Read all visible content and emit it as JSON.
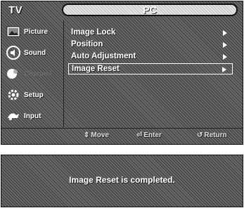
{
  "menu": {
    "source_label": "TV",
    "title": "PC",
    "sidebar": [
      {
        "label": "Picture",
        "icon": "picture-icon"
      },
      {
        "label": "Sound",
        "icon": "sound-icon"
      },
      {
        "label": "Channel",
        "icon": "channel-icon",
        "dimmed": true
      },
      {
        "label": "Setup",
        "icon": "setup-icon"
      },
      {
        "label": "Input",
        "icon": "input-icon"
      }
    ],
    "items": [
      {
        "label": "Image Lock"
      },
      {
        "label": "Position"
      },
      {
        "label": "Auto Adjustment"
      },
      {
        "label": "Image Reset",
        "selected": true
      }
    ],
    "footer": {
      "move": "Move",
      "enter": "Enter",
      "return": "Return"
    }
  },
  "message": {
    "text": "Image Reset is completed."
  }
}
